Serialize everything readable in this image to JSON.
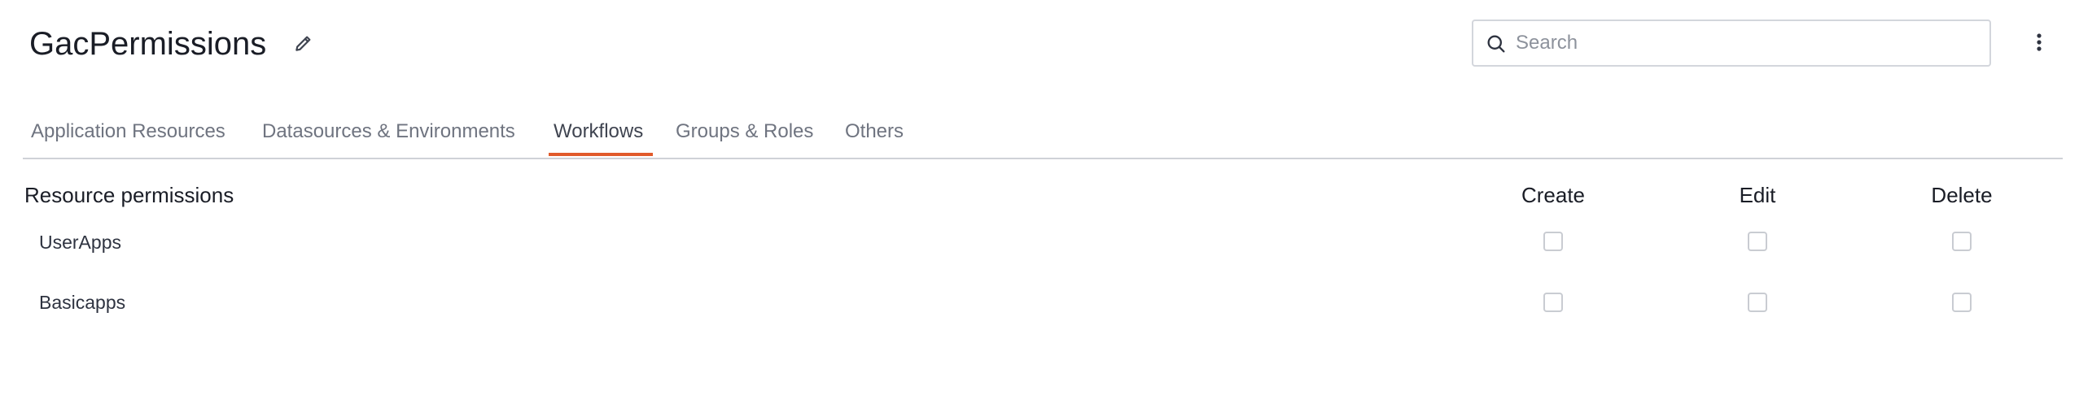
{
  "header": {
    "title": "GacPermissions",
    "edit_icon": "pencil-icon",
    "more_icon": "vertical-dots-icon"
  },
  "search": {
    "placeholder": "Search",
    "value": "",
    "icon": "search-icon"
  },
  "tabs": [
    {
      "label": "Application Resources",
      "active": false
    },
    {
      "label": "Datasources & Environments",
      "active": false
    },
    {
      "label": "Workflows",
      "active": true
    },
    {
      "label": "Groups & Roles",
      "active": false
    },
    {
      "label": "Others",
      "active": false
    }
  ],
  "colors": {
    "accent": "#e15a2b",
    "text": "#1a1d26",
    "muted": "#6f7480",
    "border": "#cfd2d7"
  },
  "permissions": {
    "section_title": "Resource permissions",
    "columns": [
      "Create",
      "Edit",
      "Delete"
    ],
    "rows": [
      {
        "label": "UserApps",
        "create": false,
        "edit": false,
        "delete": false
      },
      {
        "label": "Basicapps",
        "create": false,
        "edit": false,
        "delete": false
      }
    ]
  }
}
